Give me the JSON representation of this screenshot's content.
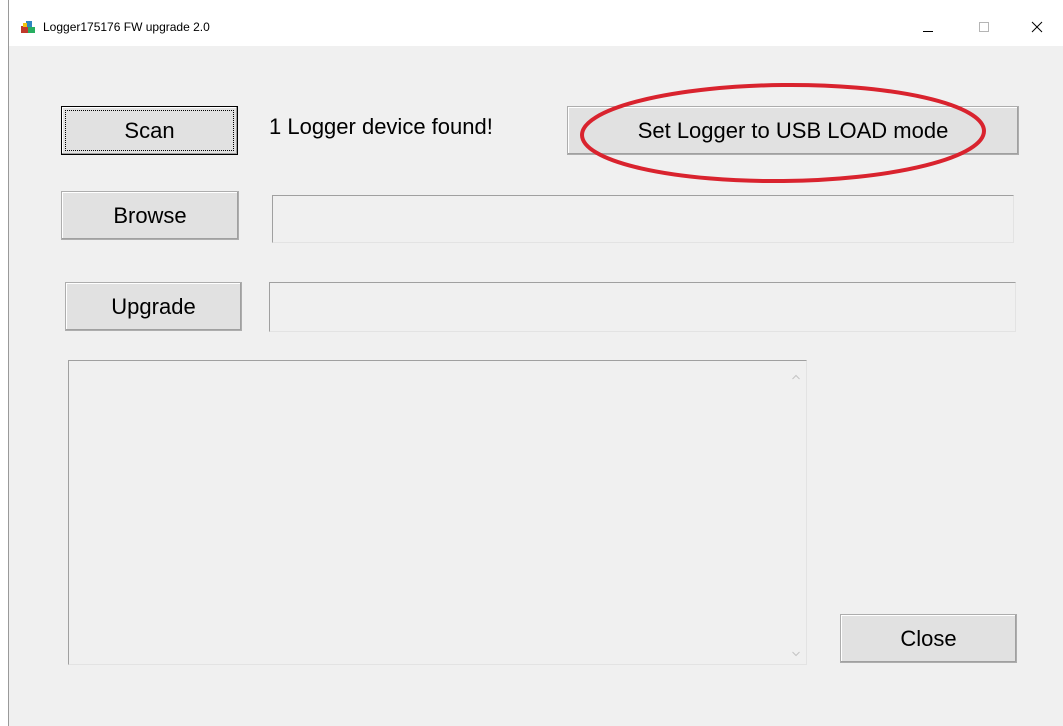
{
  "window": {
    "title": "Logger175176 FW upgrade 2.0",
    "app_icon": "app-installer-icon",
    "controls": {
      "minimize_icon": "minimize-icon",
      "maximize_icon": "maximize-icon",
      "close_icon": "close-icon"
    }
  },
  "main": {
    "scan_label": "Scan",
    "status_text": "1  Logger device found!",
    "usb_load_label": "Set Logger to USB LOAD mode",
    "browse_label": "Browse",
    "browse_path_value": "",
    "upgrade_label": "Upgrade",
    "upgrade_status_value": "",
    "log_text": "",
    "close_label": "Close"
  },
  "annotation": {
    "highlight_color": "#d9232e"
  },
  "colors": {
    "window_bg": "#f0f0f0",
    "titlebar_bg": "#ffffff",
    "button_bg": "#e1e1e1"
  }
}
